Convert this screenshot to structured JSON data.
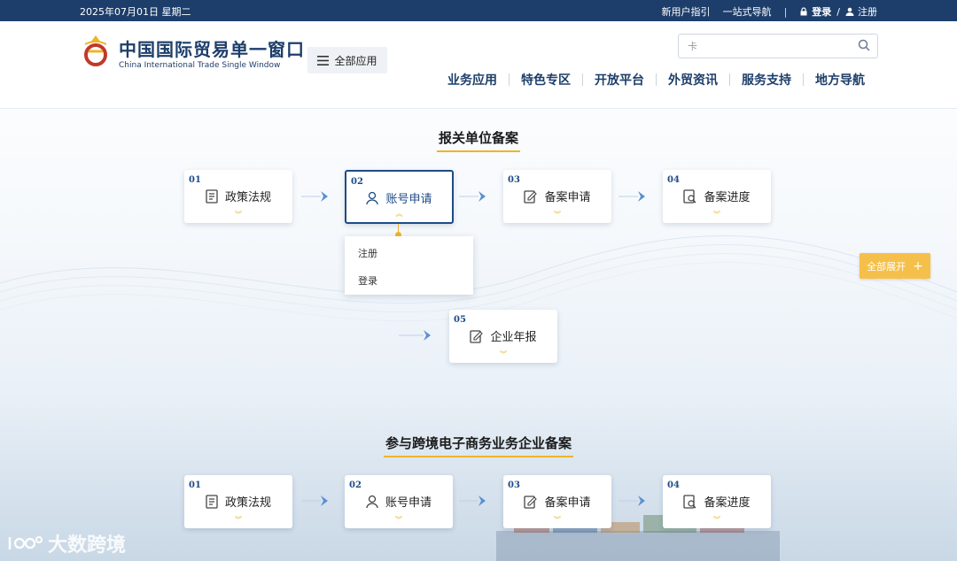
{
  "topbar": {
    "date": "2025年07月01日 星期二",
    "guide": "新用户指引",
    "onestop": "一站式导航",
    "separator": "|",
    "login": "登录",
    "slash": "/",
    "register": "注册"
  },
  "header": {
    "logo_cn": "中国国际贸易单一窗口",
    "logo_en": "China International Trade Single Window",
    "all_apps": "全部应用",
    "search_placeholder": "卡",
    "nav": [
      "业务应用",
      "特色专区",
      "开放平台",
      "外贸资讯",
      "服务支持",
      "地方导航"
    ]
  },
  "section1": {
    "title": "报关单位备案",
    "steps": [
      {
        "num": "01",
        "label": "政策法规",
        "icon": "document-icon"
      },
      {
        "num": "02",
        "label": "账号申请",
        "icon": "user-icon"
      },
      {
        "num": "03",
        "label": "备案申请",
        "icon": "edit-icon"
      },
      {
        "num": "04",
        "label": "备案进度",
        "icon": "search-doc-icon"
      },
      {
        "num": "05",
        "label": "企业年报",
        "icon": "edit-icon"
      }
    ],
    "dropdown": [
      "注册",
      "登录"
    ]
  },
  "expand_all": "全部展开",
  "section2": {
    "title": "参与跨境电子商务业务企业备案",
    "steps": [
      {
        "num": "01",
        "label": "政策法规",
        "icon": "document-icon"
      },
      {
        "num": "02",
        "label": "账号申请",
        "icon": "user-icon"
      },
      {
        "num": "03",
        "label": "备案申请",
        "icon": "edit-icon"
      },
      {
        "num": "04",
        "label": "备案进度",
        "icon": "search-doc-icon"
      }
    ]
  },
  "watermark": "大数跨境",
  "colors": {
    "brand": "#1d3e6a",
    "accent": "#f0b429",
    "active": "#1d4b88"
  }
}
